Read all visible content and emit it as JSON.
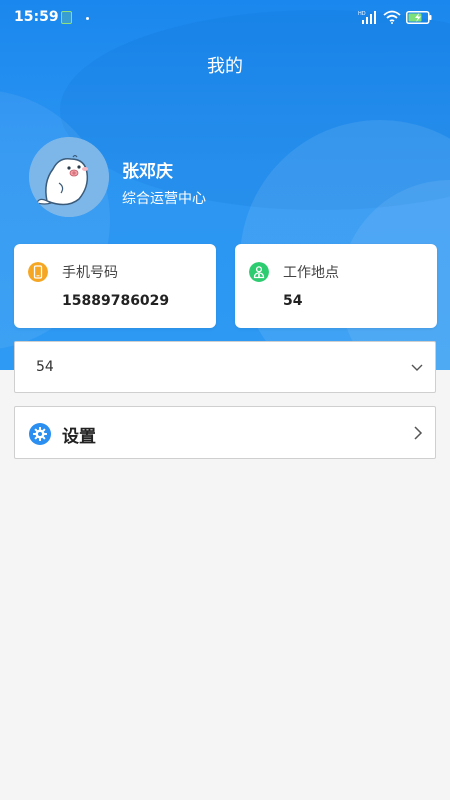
{
  "status_bar": {
    "time": "15:59",
    "network_label": "HD"
  },
  "header": {
    "title": "我的"
  },
  "profile": {
    "name": "张邓庆",
    "department": "综合运营中心"
  },
  "info_cards": {
    "phone": {
      "label": "手机号码",
      "value": "15889786029",
      "icon": "phone-icon"
    },
    "location": {
      "label": "工作地点",
      "value": "54",
      "icon": "workplace-icon"
    }
  },
  "select": {
    "value": "54"
  },
  "settings": {
    "label": "设置",
    "icon": "gear-icon"
  },
  "colors": {
    "header_blue": "#1a87ee",
    "background": "#f5f5f5",
    "phone_icon": "#f5a623",
    "location_icon": "#2ecc71",
    "gear_icon": "#2a8ff0"
  }
}
